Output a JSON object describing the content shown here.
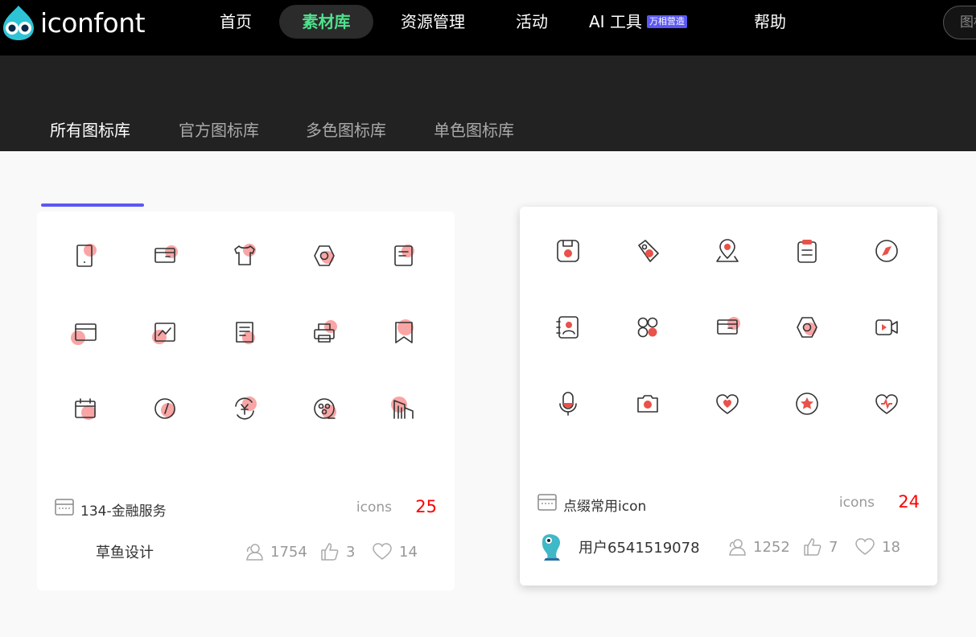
{
  "logo": {
    "text": "iconfont"
  },
  "nav": {
    "items": [
      {
        "label": "首页"
      },
      {
        "label": "素材库",
        "active": true
      },
      {
        "label": "资源管理"
      },
      {
        "label": "活动"
      },
      {
        "label": "AI 工具",
        "badge": "万相营造"
      },
      {
        "label": "帮助"
      }
    ],
    "search_placeholder": "图标"
  },
  "tabs": [
    {
      "label": "所有图标库",
      "active": true
    },
    {
      "label": "官方图标库"
    },
    {
      "label": "多色图标库"
    },
    {
      "label": "单色图标库"
    }
  ],
  "colors": {
    "accent": "#5b58f5",
    "active_nav": "#4ee38d",
    "count_red": "#ff0000",
    "icon_highlight": "#f9a5a5",
    "icon_red": "#e8524a"
  },
  "cards": [
    {
      "name": "134-金融服务",
      "icons_label": "icons",
      "icon_count": "25",
      "author": "草鱼设计",
      "stats": {
        "users": "1754",
        "likes": "3",
        "favorites": "14"
      },
      "icons": [
        "tablet-icon",
        "wallet-icon",
        "shirt-icon",
        "hexagon-icon",
        "note-icon",
        "card-icon",
        "chart-icon",
        "document-icon",
        "printer-icon",
        "bookmark-icon",
        "calendar-icon",
        "gauge-icon",
        "yen-cycle-icon",
        "coins-icon",
        "building-icon"
      ]
    },
    {
      "name": "点缀常用icon",
      "icons_label": "icons",
      "icon_count": "24",
      "author": "用户6541519078",
      "stats": {
        "users": "1252",
        "likes": "7",
        "favorites": "18"
      },
      "icons": [
        "save-icon",
        "tag-icon",
        "location-pin-icon",
        "clipboard-icon",
        "compass-icon",
        "contacts-icon",
        "apps-icon",
        "wallet-icon",
        "hexagon-icon",
        "video-icon",
        "microphone-icon",
        "camera-icon",
        "heart-icon",
        "star-badge-icon",
        "heart-pulse-icon"
      ]
    }
  ]
}
